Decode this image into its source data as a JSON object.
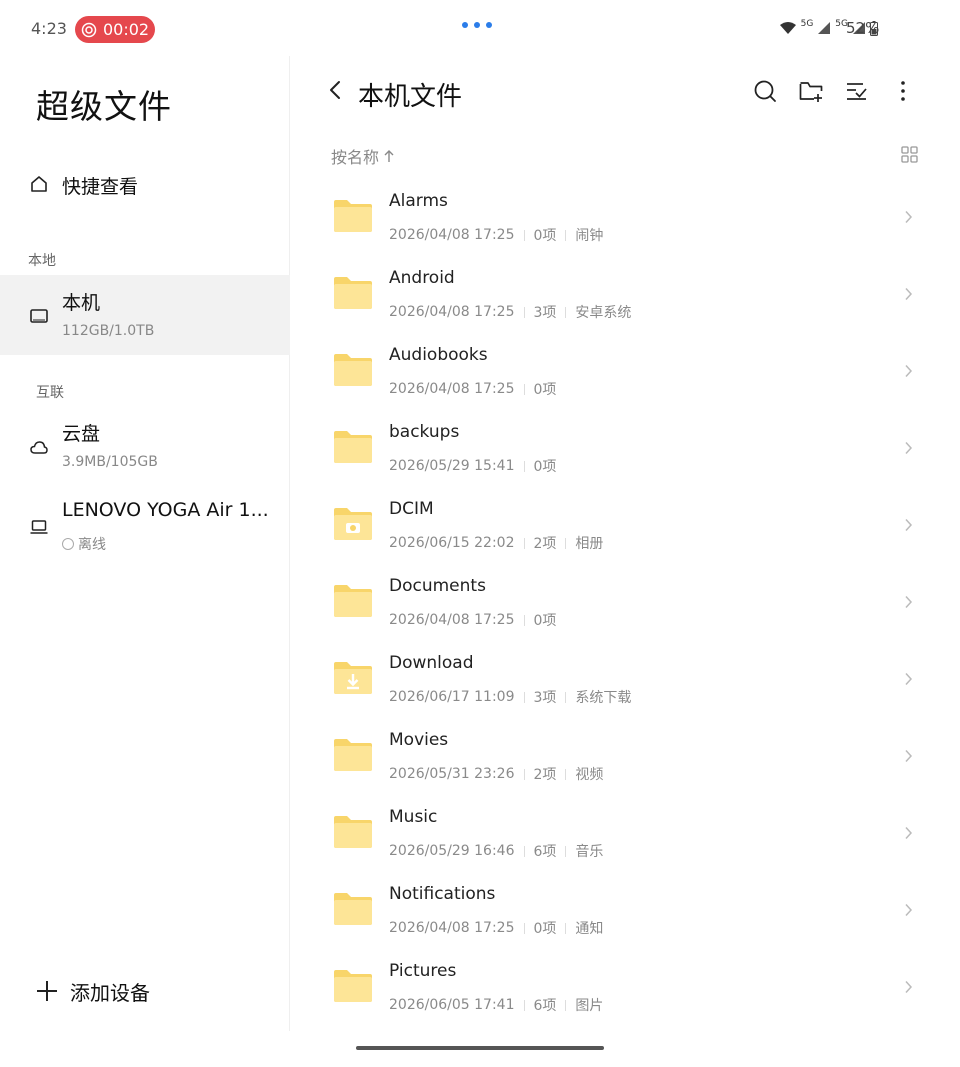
{
  "status": {
    "time": "4:23",
    "recording_timer": "00:02",
    "signal1": "5G",
    "signal2": "5G",
    "battery": "52%"
  },
  "sidebar": {
    "title": "超级文件",
    "quick_view": "快捷查看",
    "section_local": "本地",
    "section_connected": "互联",
    "devices": [
      {
        "name": "本机",
        "sub": "112GB/1.0TB"
      },
      {
        "name": "云盘",
        "sub": "3.9MB/105GB"
      },
      {
        "name": "LENOVO YOGA Air 1...",
        "sub": "离线"
      }
    ],
    "add_device": "添加设备"
  },
  "main": {
    "title": "本机文件",
    "sort_label": "按名称",
    "files": [
      {
        "name": "Alarms",
        "date": "2026/04/08 17:25",
        "count": "0项",
        "tag": "闹钟",
        "icon": "folder-icon"
      },
      {
        "name": "Android",
        "date": "2026/04/08 17:25",
        "count": "3项",
        "tag": "安卓系统",
        "icon": "folder-icon"
      },
      {
        "name": "Audiobooks",
        "date": "2026/04/08 17:25",
        "count": "0项",
        "tag": "",
        "icon": "folder-icon"
      },
      {
        "name": "backups",
        "date": "2026/05/29 15:41",
        "count": "0项",
        "tag": "",
        "icon": "folder-icon"
      },
      {
        "name": "DCIM",
        "date": "2026/06/15 22:02",
        "count": "2项",
        "tag": "相册",
        "icon": "camera-folder-icon"
      },
      {
        "name": "Documents",
        "date": "2026/04/08 17:25",
        "count": "0项",
        "tag": "",
        "icon": "folder-icon"
      },
      {
        "name": "Download",
        "date": "2026/06/17 11:09",
        "count": "3项",
        "tag": "系统下载",
        "icon": "download-folder-icon"
      },
      {
        "name": "Movies",
        "date": "2026/05/31 23:26",
        "count": "2项",
        "tag": "视频",
        "icon": "folder-icon"
      },
      {
        "name": "Music",
        "date": "2026/05/29 16:46",
        "count": "6项",
        "tag": "音乐",
        "icon": "folder-icon"
      },
      {
        "name": "Notifications",
        "date": "2026/04/08 17:25",
        "count": "0项",
        "tag": "通知",
        "icon": "folder-icon"
      },
      {
        "name": "Pictures",
        "date": "2026/06/05 17:41",
        "count": "6项",
        "tag": "图片",
        "icon": "folder-icon"
      }
    ]
  },
  "colors": {
    "accent": "#2b7de9",
    "recording": "#e5484d",
    "folder_back": "#f8d56a",
    "folder_front": "#fde597"
  }
}
